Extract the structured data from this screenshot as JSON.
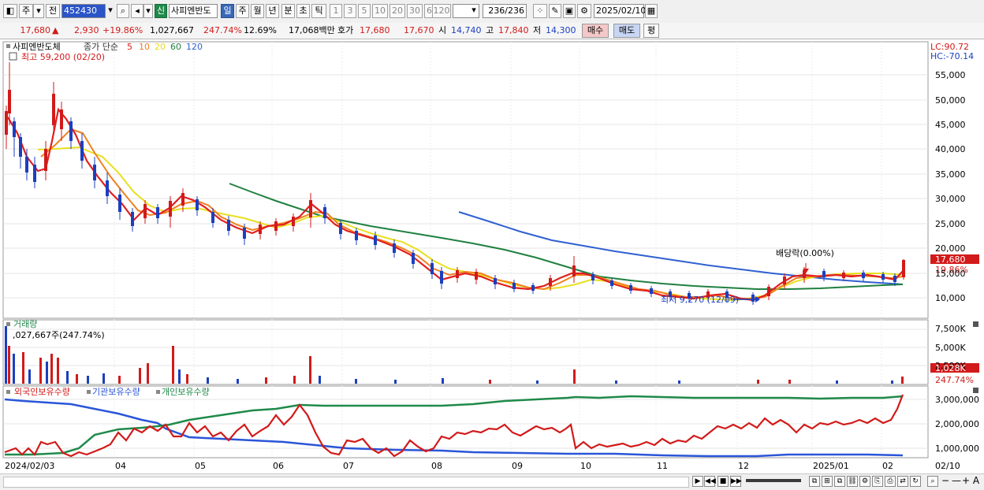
{
  "toolbar": {
    "market": "주",
    "prev": "전",
    "code": "452430",
    "badge": "신",
    "name": "사피엔반도",
    "periods": [
      "일",
      "주",
      "월",
      "년",
      "분",
      "초",
      "틱"
    ],
    "intervals": [
      "1",
      "3",
      "5",
      "10",
      "20",
      "30",
      "60",
      "120"
    ],
    "count": "236",
    "total": "/236",
    "date": "2025/02/10"
  },
  "quote": {
    "price": "17,680",
    "change": "2,930",
    "change_pct": "+19.86%",
    "volume": "1,027,667",
    "vol_ratio": "247.74%",
    "turnover": "12.69%",
    "amount": "17,068백만",
    "bid_label": "호가",
    "ask": "17,680",
    "bid": "17,670",
    "open_label": "시",
    "open": "14,740",
    "high_label": "고",
    "high": "17,840",
    "low_label": "저",
    "low": "14,300",
    "buy_btn": "매수",
    "sell_btn": "매도",
    "eval_btn": "평"
  },
  "price_panel": {
    "stock_label": "사피엔반도체",
    "ma_label": "종가 단순",
    "ma_periods": [
      {
        "p": "5",
        "color": "#e02020"
      },
      {
        "p": "10",
        "color": "#f08020"
      },
      {
        "p": "20",
        "color": "#e8d820"
      },
      {
        "p": "60",
        "color": "#208040"
      },
      {
        "p": "120",
        "color": "#3060d0"
      }
    ],
    "high_note": "최고 59,200 (02/20)",
    "low_note": "최저 9,270 (12/09)",
    "dividend_note": "배당락(0.00%)",
    "lc": "LC:90.72",
    "hc": "HC:-70.14",
    "price_tag": "17,680",
    "pct_tag": "19.86%",
    "y_ticks": [
      "55,000",
      "50,000",
      "45,000",
      "40,000",
      "35,000",
      "30,000",
      "25,000",
      "20,000",
      "15,000",
      "10,000"
    ]
  },
  "volume_panel": {
    "title": "거래량",
    "note": ",027,667주(247.74%)",
    "y_ticks": [
      "7,500K",
      "5,000K",
      "2,500K"
    ],
    "vol_tag": "1,028K",
    "pct_tag": "247.74%"
  },
  "holding_panel": {
    "legend": [
      "외국인보유수량",
      "기관보유수량",
      "개인보유수량"
    ],
    "legend_colors": [
      "#d21a1a",
      "#2a55d8",
      "#1f8a4a"
    ],
    "y_ticks": [
      "3,000,000",
      "2,000,000",
      "1,000,000"
    ]
  },
  "x_axis": {
    "labels": [
      "2024/02/03",
      "04",
      "05",
      "06",
      "07",
      "08",
      "09",
      "10",
      "11",
      "12",
      "2025/01",
      "02"
    ],
    "end_label": "02/10"
  },
  "chart_data": {
    "type": "line",
    "price_series": [
      {
        "name": "종가",
        "values": [
          38000,
          52000,
          44000,
          36000,
          33000,
          48000,
          45000,
          40000,
          35000,
          30000,
          25000,
          26000,
          28000,
          30000,
          28000,
          25000,
          23000,
          23500,
          25000,
          26000,
          28000,
          24000,
          22000,
          21500,
          21000,
          20000,
          18000,
          15500,
          14500,
          15000,
          14000,
          13000,
          12500,
          13000,
          14000,
          16000,
          14500,
          13500,
          12500,
          12000,
          11500,
          11200,
          11000,
          10500,
          10000,
          9500,
          11000,
          13000,
          14000,
          14500,
          14000,
          13800,
          13900,
          14000,
          13500,
          13000,
          17680
        ]
      },
      {
        "name": "120",
        "values": [
          null,
          null,
          null,
          null,
          null,
          null,
          null,
          null,
          null,
          null,
          null,
          null,
          null,
          null,
          null,
          null,
          null,
          null,
          null,
          null,
          null,
          null,
          null,
          null,
          null,
          null,
          27000,
          25500,
          24000,
          23000,
          22000,
          21000,
          20000,
          19000,
          18000,
          17500,
          17000,
          16500,
          16000,
          15500,
          15000,
          14500,
          14000,
          13500,
          13200,
          13000,
          13000,
          12800,
          12700,
          12600,
          12700,
          12800,
          12800,
          12900,
          13000,
          13000,
          13200
        ]
      }
    ],
    "ylim": [
      8000,
      60000
    ]
  }
}
